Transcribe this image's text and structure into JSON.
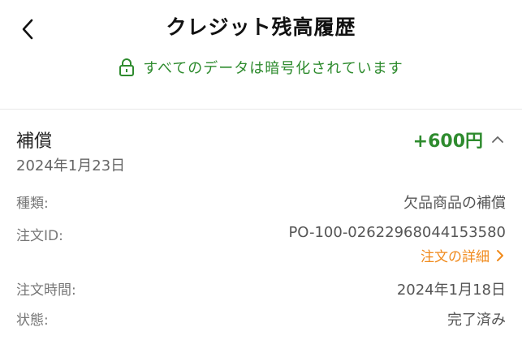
{
  "header": {
    "title": "クレジット残高履歴"
  },
  "security_notice": "すべてのデータは暗号化されています",
  "entry": {
    "title": "補償",
    "date": "2024年1月23日",
    "amount": "+600円",
    "details": [
      {
        "label": "種類:",
        "value": "欠品商品の補償"
      },
      {
        "label": "注文ID:",
        "value": "PO-100-02622968044153580"
      },
      {
        "label": "注文時間:",
        "value": "2024年1月18日"
      },
      {
        "label": "状態:",
        "value": "完了済み"
      }
    ],
    "order_detail_link": "注文の詳細"
  },
  "colors": {
    "green": "#2e8b2e",
    "orange": "#f08a1c"
  },
  "icons": [
    "back-arrow-icon",
    "lock-icon",
    "chevron-up-icon",
    "chevron-right-icon"
  ]
}
